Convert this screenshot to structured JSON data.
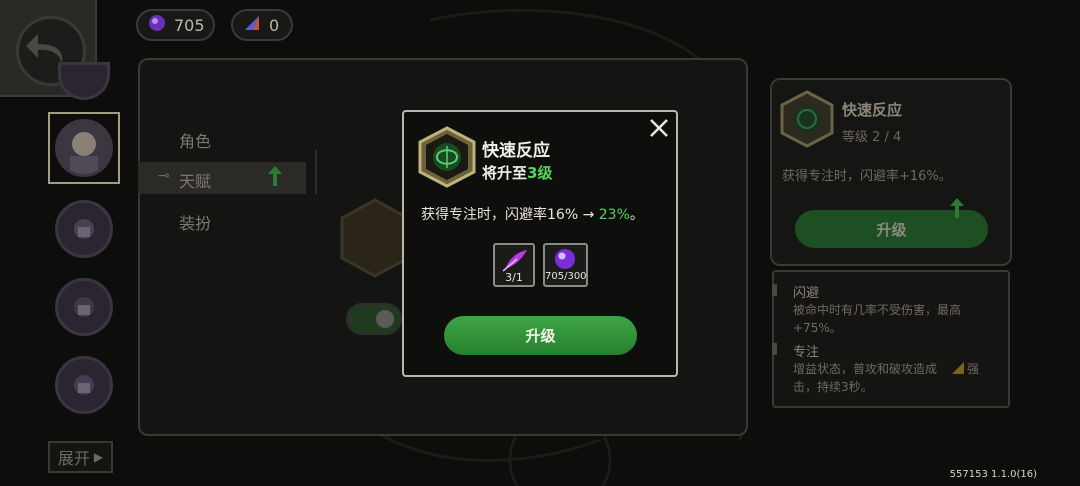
{
  "currency": {
    "gems": "705",
    "shards": "0"
  },
  "menu": {
    "items": [
      {
        "label": "角色"
      },
      {
        "label": "天赋"
      },
      {
        "label": "装扮"
      }
    ]
  },
  "expand_label": "展开",
  "side_panel": {
    "skill_name": "快速反应",
    "level_text": "等级 2 / 4",
    "effect_text": "获得专注时，闪避率+16%。",
    "upgrade_label": "升级",
    "glossary": [
      {
        "term": "闪避",
        "desc": "被命中时有几率不受伤害，最高+75%。"
      },
      {
        "term": "专注",
        "desc": "增益状态，普攻和破攻造成",
        "desc_after_icon": "强击，持续3秒。"
      }
    ]
  },
  "modal": {
    "skill_name": "快速反应",
    "upgrade_to_prefix": "将升至",
    "upgrade_to_level": "3级",
    "desc_prefix": "获得专注时，闪避率16% → ",
    "desc_new_value": "23%",
    "desc_suffix": "。",
    "costs": [
      {
        "icon": "feather-icon",
        "count": "3/1"
      },
      {
        "icon": "purple-orb-icon",
        "count": "705/300"
      }
    ],
    "upgrade_label": "升级"
  },
  "version": "557153 1.1.0(16)",
  "colors": {
    "accent_green": "#55d35a",
    "button_green": "#2f9237",
    "gem_purple": "#7a3cc9"
  }
}
